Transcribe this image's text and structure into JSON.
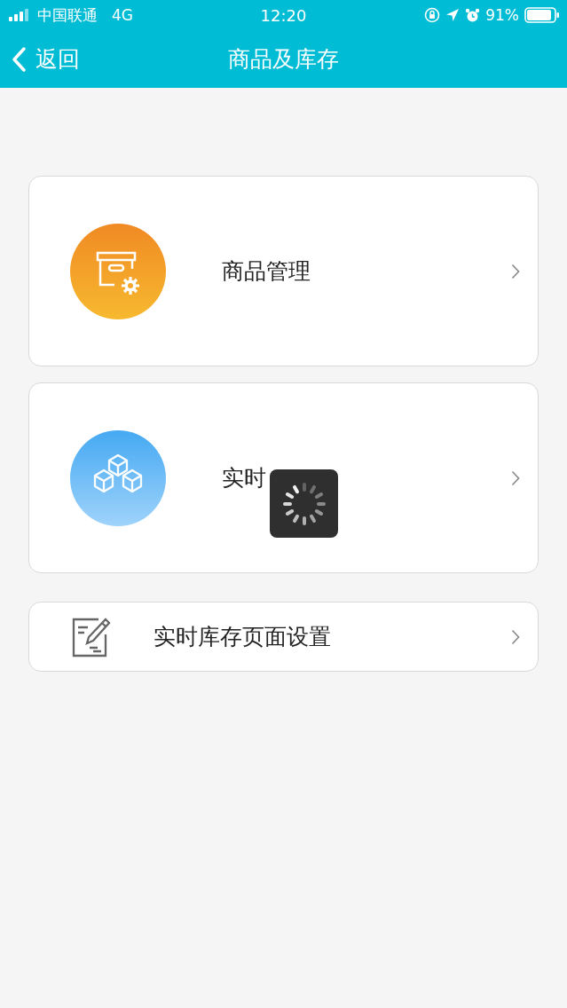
{
  "status_bar": {
    "carrier": "中国联通",
    "network": "4G",
    "time": "12:20",
    "battery": "91%"
  },
  "nav": {
    "back": "返回",
    "title": "商品及库存"
  },
  "items": [
    {
      "kind": "goods",
      "label": "商品管理"
    },
    {
      "kind": "stock",
      "label": "实时"
    },
    {
      "kind": "settings",
      "label": "实时库存页面设置"
    }
  ],
  "loading": true
}
